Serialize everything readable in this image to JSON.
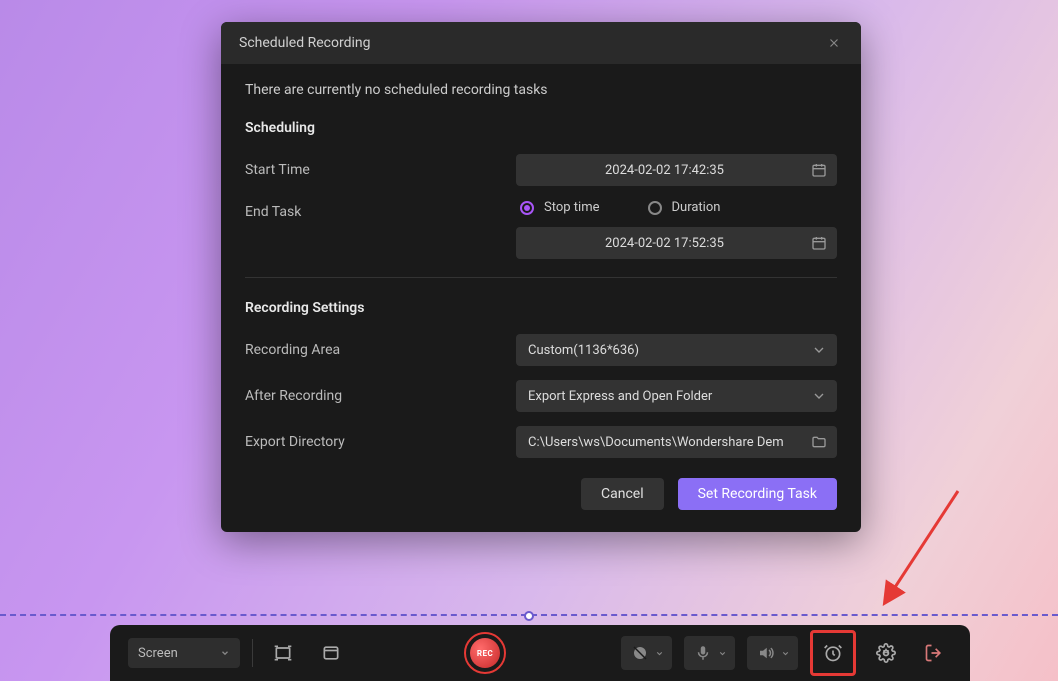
{
  "dialog": {
    "title": "Scheduled Recording",
    "empty_message": "There are currently no scheduled recording tasks",
    "scheduling": {
      "heading": "Scheduling",
      "start_time_label": "Start Time",
      "start_time_value": "2024-02-02 17:42:35",
      "end_task_label": "End Task",
      "radio_stop_time": "Stop time",
      "radio_duration": "Duration",
      "end_time_value": "2024-02-02 17:52:35"
    },
    "recording_settings": {
      "heading": "Recording Settings",
      "recording_area_label": "Recording Area",
      "recording_area_value": "Custom(1136*636)",
      "after_recording_label": "After Recording",
      "after_recording_value": "Export Express and Open Folder",
      "export_dir_label": "Export Directory",
      "export_dir_value": "C:\\Users\\ws\\Documents\\Wondershare Dem"
    },
    "buttons": {
      "cancel": "Cancel",
      "set_task": "Set Recording Task"
    }
  },
  "toolbar": {
    "mode": "Screen",
    "rec_label": "REC"
  },
  "colors": {
    "accent": "#8b6ff5",
    "danger": "#e53935",
    "dialog_bg": "#1a1a1a"
  }
}
